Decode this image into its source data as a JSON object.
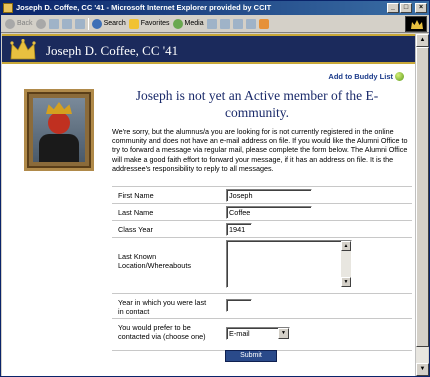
{
  "window": {
    "title": "Joseph D. Coffee, CC '41 - Microsoft Internet Explorer provided by CCIT",
    "controls": [
      "_",
      "□",
      "×"
    ]
  },
  "toolbar": {
    "back_label": "Back",
    "forward_label": "→",
    "search_label": "Search",
    "favorites_label": "Favorites",
    "media_label": "Media"
  },
  "header": {
    "title": "Joseph D. Coffee, CC '41"
  },
  "buddy_link": "Add to Buddy List",
  "heading": "Joseph is not yet an Active member of the E-community.",
  "intro": "We're sorry, but the alumnus/a you are looking for is not currently registered in the online community and does not have an e-mail address on file. If you would like the Alumni Office to try to forward a message via regular mail, please complete the form below. The Alumni Office will make a good faith effort to forward your message, if it has an address on file. It is the addressee's responsibility to reply to all messages.",
  "form": {
    "first_name": {
      "label": "First Name",
      "value": "Joseph"
    },
    "last_name": {
      "label": "Last Name",
      "value": "Coffee"
    },
    "class_year": {
      "label": "Class Year",
      "value": "1941"
    },
    "whereabouts": {
      "label": "Last Known Location/Whereabouts",
      "value": ""
    },
    "last_contact": {
      "label": "Year in which you were last in contact",
      "value": ""
    },
    "contact_pref": {
      "label": "You would prefer to be contacted via (choose one)",
      "value": "E-mail"
    },
    "submit_label": "Submit"
  },
  "colors": {
    "header_bg": "#1b2a5c",
    "header_trim": "#c8a838",
    "heading_text": "#1a2a6a",
    "submit_bg": "#2a4a8a"
  }
}
